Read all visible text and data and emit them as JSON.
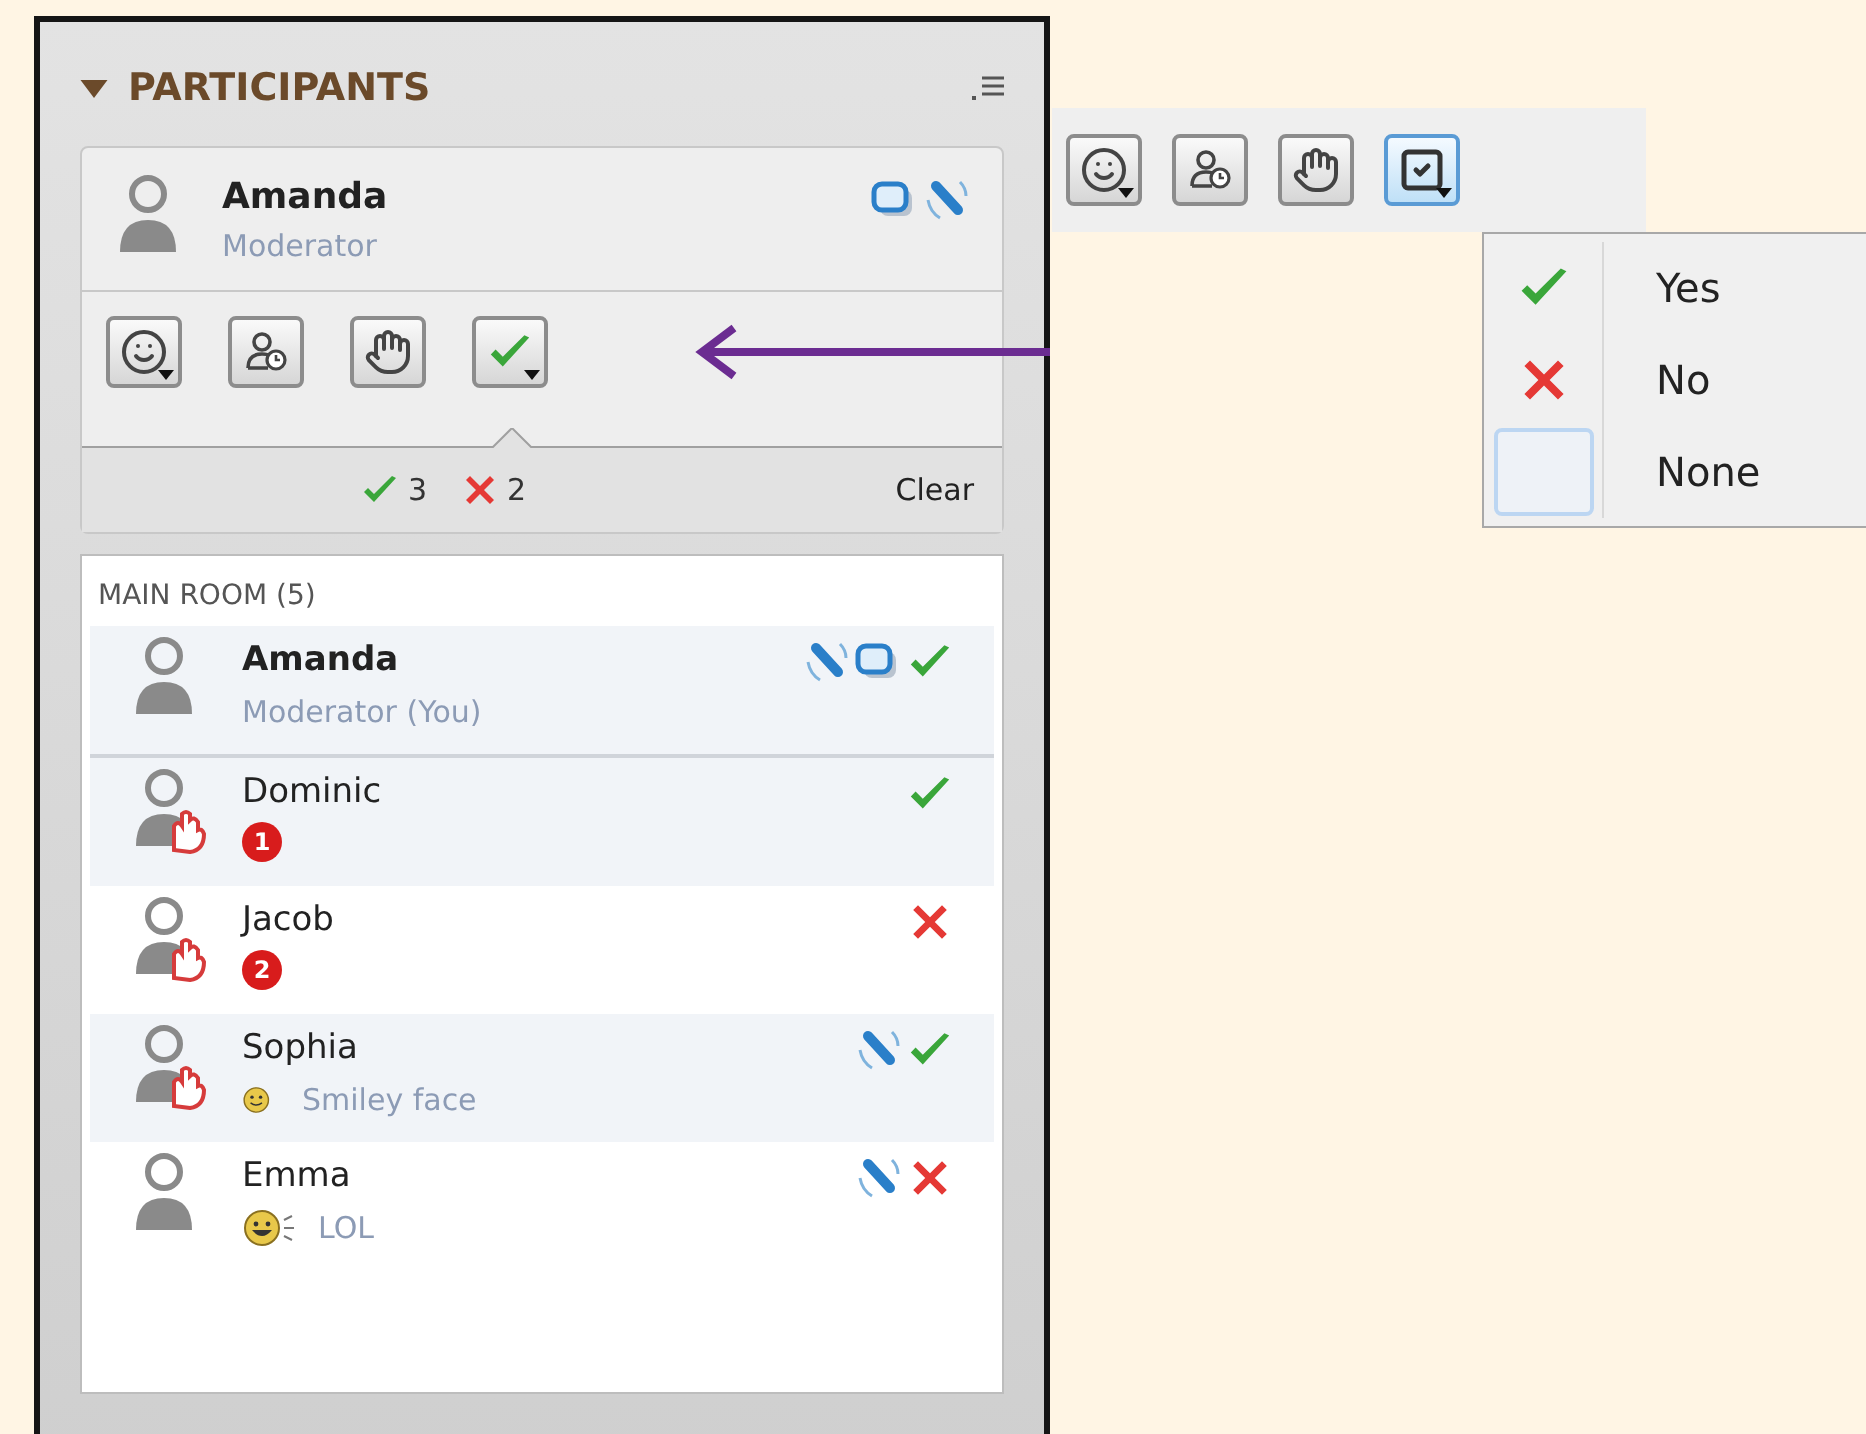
{
  "panel": {
    "title": "PARTICIPANTS",
    "me": {
      "name": "Amanda",
      "role": "Moderator",
      "camera": true,
      "mic": true
    },
    "tools": [
      {
        "kind": "emoji",
        "dropdown": true,
        "selected": false
      },
      {
        "kind": "away",
        "dropdown": false,
        "selected": false
      },
      {
        "kind": "hand",
        "dropdown": false,
        "selected": false
      },
      {
        "kind": "vote_yes",
        "dropdown": true,
        "selected": false
      }
    ],
    "vote_summary": {
      "yes": "3",
      "no": "2",
      "clear": "Clear"
    },
    "room": {
      "title": "MAIN ROOM (5)",
      "participants": [
        {
          "name": "Amanda",
          "role": "Moderator (You)",
          "moderator": true,
          "shaded": true,
          "hand_raised": false,
          "mic": true,
          "camera": true,
          "vote": {
            "kind": "yes"
          }
        },
        {
          "name": "Dominic",
          "moderator": false,
          "shaded": true,
          "hand_raised": true,
          "hand_order": "1",
          "mic": false,
          "camera": false,
          "vote": {
            "kind": "yes"
          }
        },
        {
          "name": "Jacob",
          "moderator": false,
          "shaded": false,
          "hand_raised": true,
          "hand_order": "2",
          "mic": false,
          "camera": false,
          "vote": {
            "kind": "no"
          }
        },
        {
          "name": "Sophia",
          "moderator": false,
          "shaded": true,
          "hand_raised": true,
          "emoji": {
            "kind": "smile",
            "label": "Smiley face"
          },
          "mic": true,
          "camera": false,
          "vote": {
            "kind": "yes"
          }
        },
        {
          "name": "Emma",
          "moderator": false,
          "shaded": false,
          "hand_raised": false,
          "emoji": {
            "kind": "laugh",
            "label": "LOL"
          },
          "mic": true,
          "camera": false,
          "vote": {
            "kind": "no"
          }
        }
      ]
    }
  },
  "callout": {
    "tools": [
      {
        "kind": "emoji",
        "dropdown": true,
        "selected": false
      },
      {
        "kind": "away",
        "dropdown": false,
        "selected": false
      },
      {
        "kind": "hand",
        "dropdown": false,
        "selected": false
      },
      {
        "kind": "vote_box",
        "dropdown": true,
        "selected": true
      }
    ],
    "menu": [
      {
        "kind": "yes",
        "label": "Yes"
      },
      {
        "kind": "no",
        "label": "No"
      },
      {
        "kind": "none",
        "label": "None"
      }
    ]
  }
}
